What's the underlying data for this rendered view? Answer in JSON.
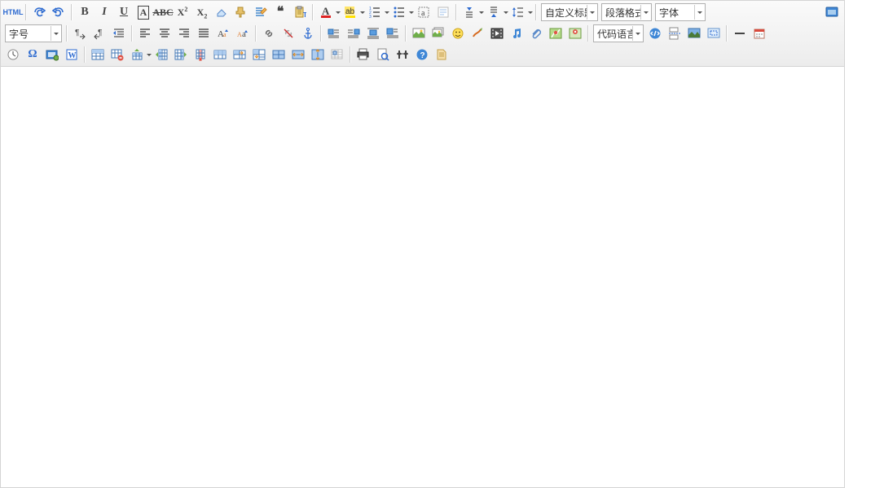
{
  "combos": {
    "custom_heading": "自定义标题",
    "paragraph": "段落格式",
    "font_family": "字体",
    "font_size": "字号",
    "code_lang": "代码语言"
  },
  "icons": {
    "source": "HTML",
    "undo": "undo",
    "redo": "redo",
    "bold": "B",
    "italic": "I",
    "underline": "U",
    "fontborder": "A",
    "strike": "ABC",
    "sup": "X²",
    "sub": "X₂",
    "eraser": "erase",
    "formatbrush": "brush",
    "autotype": "auto",
    "blockquote": "“",
    "pasteplain": "paste",
    "forecolor": "A",
    "backcolor": "ab",
    "indent": "indent",
    "outdent": "outdent",
    "selectall": "a",
    "paragraph": "¶",
    "rowspace": "rowspace",
    "spaceafter": "after",
    "lineheight": "lineheight",
    "ltr": "LTR",
    "rtl": "RTL",
    "indent2": "indent",
    "jleft": "L",
    "jcenter": "C",
    "jright": "R",
    "jfull": "J",
    "touppercase": "up",
    "tolowercase": "low",
    "link": "link",
    "unlink": "unlink",
    "anchor": "anchor",
    "imgleft": "L",
    "imgright": "R",
    "imgcenter": "C",
    "imgnone": "N",
    "simg": "img",
    "mimg": "mimg",
    "emo": "emo",
    "scrawl": "scrawl",
    "video": "vid",
    "music": "mus",
    "attach": "att",
    "map": "map",
    "gmap": "gmap",
    "hr": "hr",
    "date": "date",
    "time": "time",
    "spechar": "Ω",
    "snap": "snap",
    "wordimg": "word",
    "tins": "table",
    "tdel": "tdel",
    "trowbefore": "rb",
    "trowafter": "ra",
    "rdel": "rd",
    "colbefore": "cb",
    "colafter": "ca",
    "cdel": "cd",
    "merger": "mr",
    "merged": "md",
    "cellmerge": "cm",
    "splitr": "sr",
    "splitc": "sc",
    "splitcell": "sce",
    "splitall": "sa",
    "tbldrag": "drag",
    "print": "print",
    "preview": "prev",
    "find": "find",
    "help": "help",
    "template": "tpl",
    "fullscreen": "full",
    "codemirror": "code",
    "insertcode": "ic",
    "pagebreak": "pb",
    "background": "bg"
  }
}
